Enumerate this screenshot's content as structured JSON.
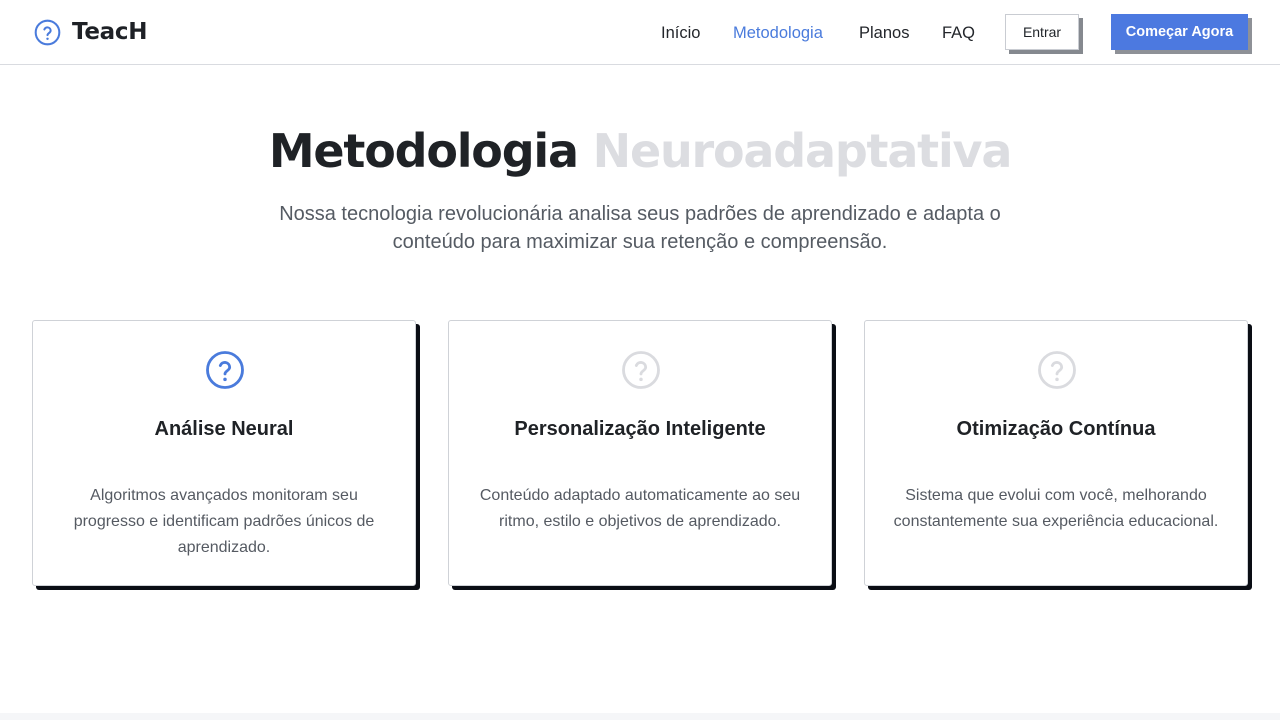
{
  "brand": {
    "name": "TeacH",
    "logo_icon": "question-circle-icon",
    "accent_color": "#4a7bdc"
  },
  "nav": {
    "items": [
      {
        "label": "Início",
        "active": false
      },
      {
        "label": "Metodologia",
        "active": true
      },
      {
        "label": "Planos",
        "active": false
      },
      {
        "label": "FAQ",
        "active": false
      }
    ],
    "login_label": "Entrar",
    "cta_label": "Começar Agora"
  },
  "hero": {
    "title_dark": "Metodologia",
    "title_light": "Neuroadaptativa",
    "subtitle": "Nossa tecnologia revolucionária analisa seus padrões de aprendizado e adapta o conteúdo para maximizar sua retenção e compreensão."
  },
  "features": [
    {
      "icon": "question-circle-icon",
      "highlighted": true,
      "title": "Análise Neural",
      "description": "Algoritmos avançados monitoram seu progresso e identificam padrões únicos de aprendizado."
    },
    {
      "icon": "question-circle-icon",
      "highlighted": false,
      "title": "Personalização Inteligente",
      "description": "Conteúdo adaptado automaticamente ao seu ritmo, estilo e objetivos de aprendizado."
    },
    {
      "icon": "question-circle-icon",
      "highlighted": false,
      "title": "Otimização Contínua",
      "description": "Sistema que evolui com você, melhorando constantemente sua experiência educacional."
    }
  ]
}
